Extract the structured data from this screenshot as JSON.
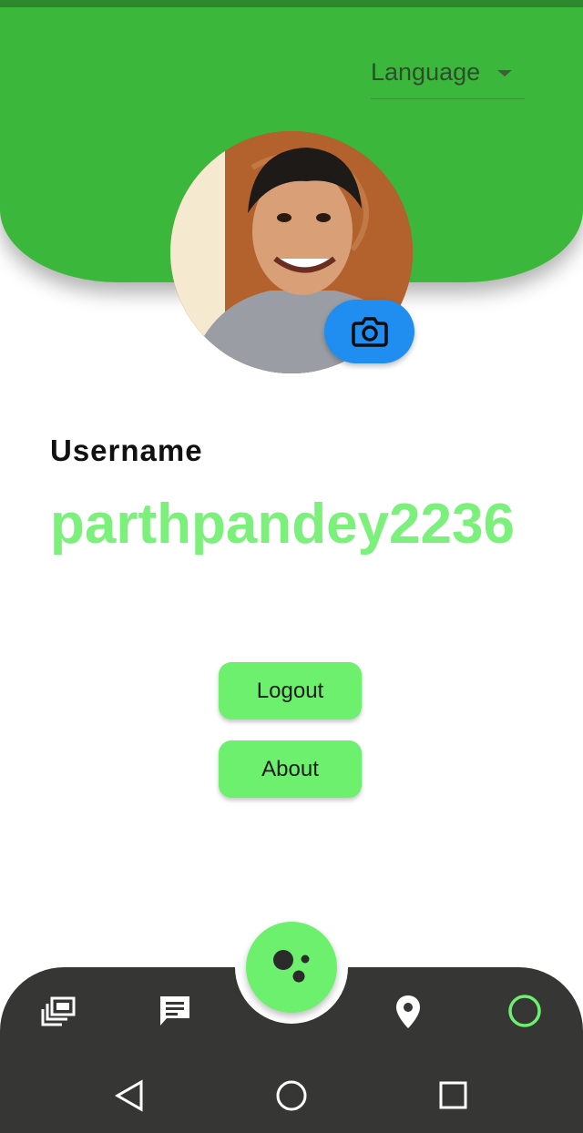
{
  "header": {
    "language_label": "Language",
    "colors": {
      "header_green": "#3bb83b",
      "accent_green": "#6df06d",
      "camera_blue": "#1f8ef0"
    }
  },
  "profile": {
    "avatar_icon": "avatar",
    "camera_icon": "camera-icon",
    "username_label": "Username",
    "username_value": "parthpandey2236"
  },
  "actions": {
    "logout_label": "Logout",
    "about_label": "About"
  },
  "bottom_nav": {
    "items": [
      {
        "icon": "gallery-icon"
      },
      {
        "icon": "chat-icon"
      },
      {
        "icon": "assistant-icon"
      },
      {
        "icon": "location-pin-icon"
      },
      {
        "icon": "status-ring-icon"
      }
    ]
  },
  "system_nav": {
    "items": [
      {
        "icon": "back-icon"
      },
      {
        "icon": "home-icon"
      },
      {
        "icon": "recents-icon"
      }
    ]
  }
}
